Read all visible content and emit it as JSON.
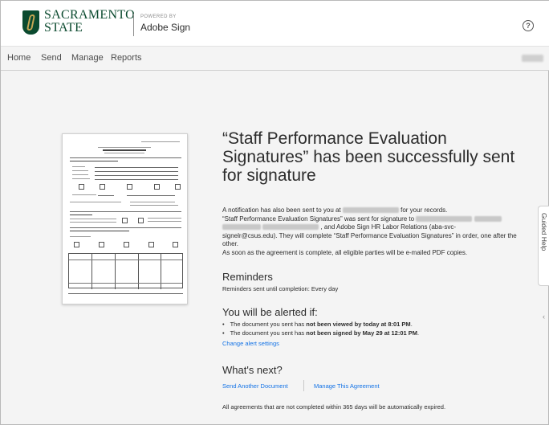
{
  "brand": {
    "name_line1": "SACRAMENTO",
    "name_line2": "STATE",
    "powered_by": "POWERED BY",
    "product": "Adobe Sign",
    "help_label": "?"
  },
  "nav": {
    "items": [
      "Home",
      "Send",
      "Manage",
      "Reports"
    ]
  },
  "main": {
    "title": "“Staff Performance Evaluation Signatures” has been successfully sent for signature",
    "notification": {
      "line1_start": "A notification has also been sent to you at",
      "line1_end": "for your records.",
      "line2_start": "“Staff Performance Evaluation Signatures” was sent for signature to",
      "line3_end": ", and Adobe Sign HR Labor Relations (aba-svc-",
      "line4": "signelr@csus.edu). They will complete “Staff Performance Evaluation Signatures” in order, one after the",
      "line5": "other.",
      "line6": "As soon as the agreement is complete, all eligible parties will be e-mailed PDF copies."
    },
    "reminders": {
      "heading": "Reminders",
      "text": "Reminders sent until completion: Every day"
    },
    "alerts": {
      "heading": "You will be alerted if:",
      "item1_start": "The document you sent has ",
      "item1_bold": "not been viewed by today at 8:01 PM",
      "item1_end": ".",
      "item2_start": "The document you sent has ",
      "item2_bold": "not been signed by May 29 at 12:01 PM",
      "item2_end": ".",
      "change_link": "Change alert settings"
    },
    "next": {
      "heading": "What's next?",
      "send_another": "Send Another Document",
      "manage": "Manage This Agreement",
      "expiry": "All agreements that are not completed within 365 days will be automatically expired."
    }
  },
  "guided_help": {
    "label": "Guided Help",
    "arrow": "‹"
  },
  "colors": {
    "brand_green": "#0b4a2f",
    "brand_gold": "#c4a654",
    "link_blue": "#1473e6",
    "page_bg": "#f4f4f4"
  }
}
